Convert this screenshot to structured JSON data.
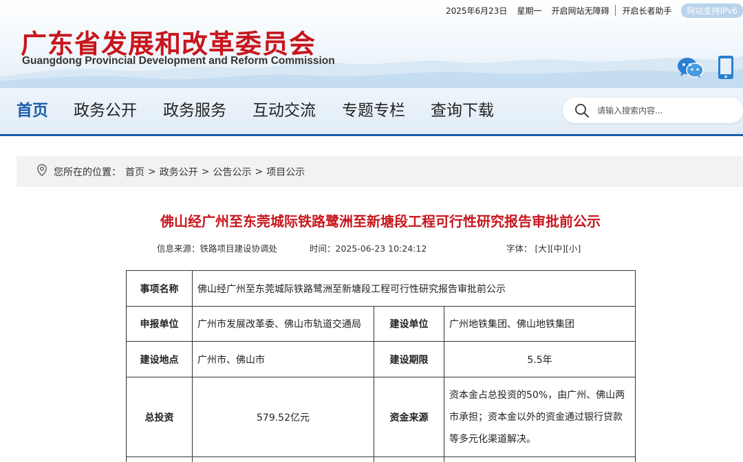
{
  "topbar": {
    "date": "2025年6月23日",
    "weekday": "星期一",
    "accessibility": "开启网站无障碍",
    "elder_mode": "开启长者助手",
    "ipv6": "网站支持IPv6"
  },
  "header": {
    "title_cn": "广东省发展和改革委员会",
    "title_en": "Guangdong Provincial Development and Reform Commission",
    "icons": [
      "wechat-icon",
      "mobile-icon"
    ],
    "brand_color": "#c8161d"
  },
  "nav": {
    "items": [
      {
        "label": "首页",
        "active": true
      },
      {
        "label": "政务公开",
        "active": false
      },
      {
        "label": "政务服务",
        "active": false
      },
      {
        "label": "互动交流",
        "active": false
      },
      {
        "label": "专题专栏",
        "active": false
      },
      {
        "label": "查询下载",
        "active": false
      }
    ],
    "accent_color": "#1a5da8",
    "search_placeholder": "请输入搜索内容..."
  },
  "breadcrumb": {
    "prefix": "您所在的位置：",
    "items": [
      "首页",
      "政务公开",
      "公告公示",
      "项目公示"
    ],
    "separator": ">",
    "icon": "location-icon"
  },
  "article": {
    "title": "佛山经广州至东莞城际铁路鹭洲至新塘段工程可行性研究报告审批前公示",
    "source_label": "信息来源：",
    "source": "铁路项目建设协调处",
    "time_label": "时间：",
    "time": "2025-06-23 10:24:12",
    "font_label": "字体：",
    "font_sizes": [
      "[大]",
      "[中]",
      "[小]"
    ]
  },
  "table": {
    "rows": [
      [
        {
          "label": "事项名称",
          "value": "佛山经广州至东莞城际铁路鹭洲至新塘段工程可行性研究报告审批前公示"
        }
      ],
      [
        {
          "label": "申报单位",
          "value": "广州市发展改革委、佛山市轨道交通局"
        },
        {
          "label": "建设单位",
          "value": "广州地铁集团、佛山地铁集团"
        }
      ],
      [
        {
          "label": "建设地点",
          "value": "广州市、佛山市"
        },
        {
          "label": "建设期限",
          "value": "5.5年"
        }
      ],
      [
        {
          "label": "总投资",
          "value": "579.52亿元"
        },
        {
          "label": "资金来源",
          "value": "资本金占总投资的50%，由广州、佛山两市承担；资本金以外的资金通过银行贷款等多元化渠道解决。"
        }
      ]
    ]
  }
}
